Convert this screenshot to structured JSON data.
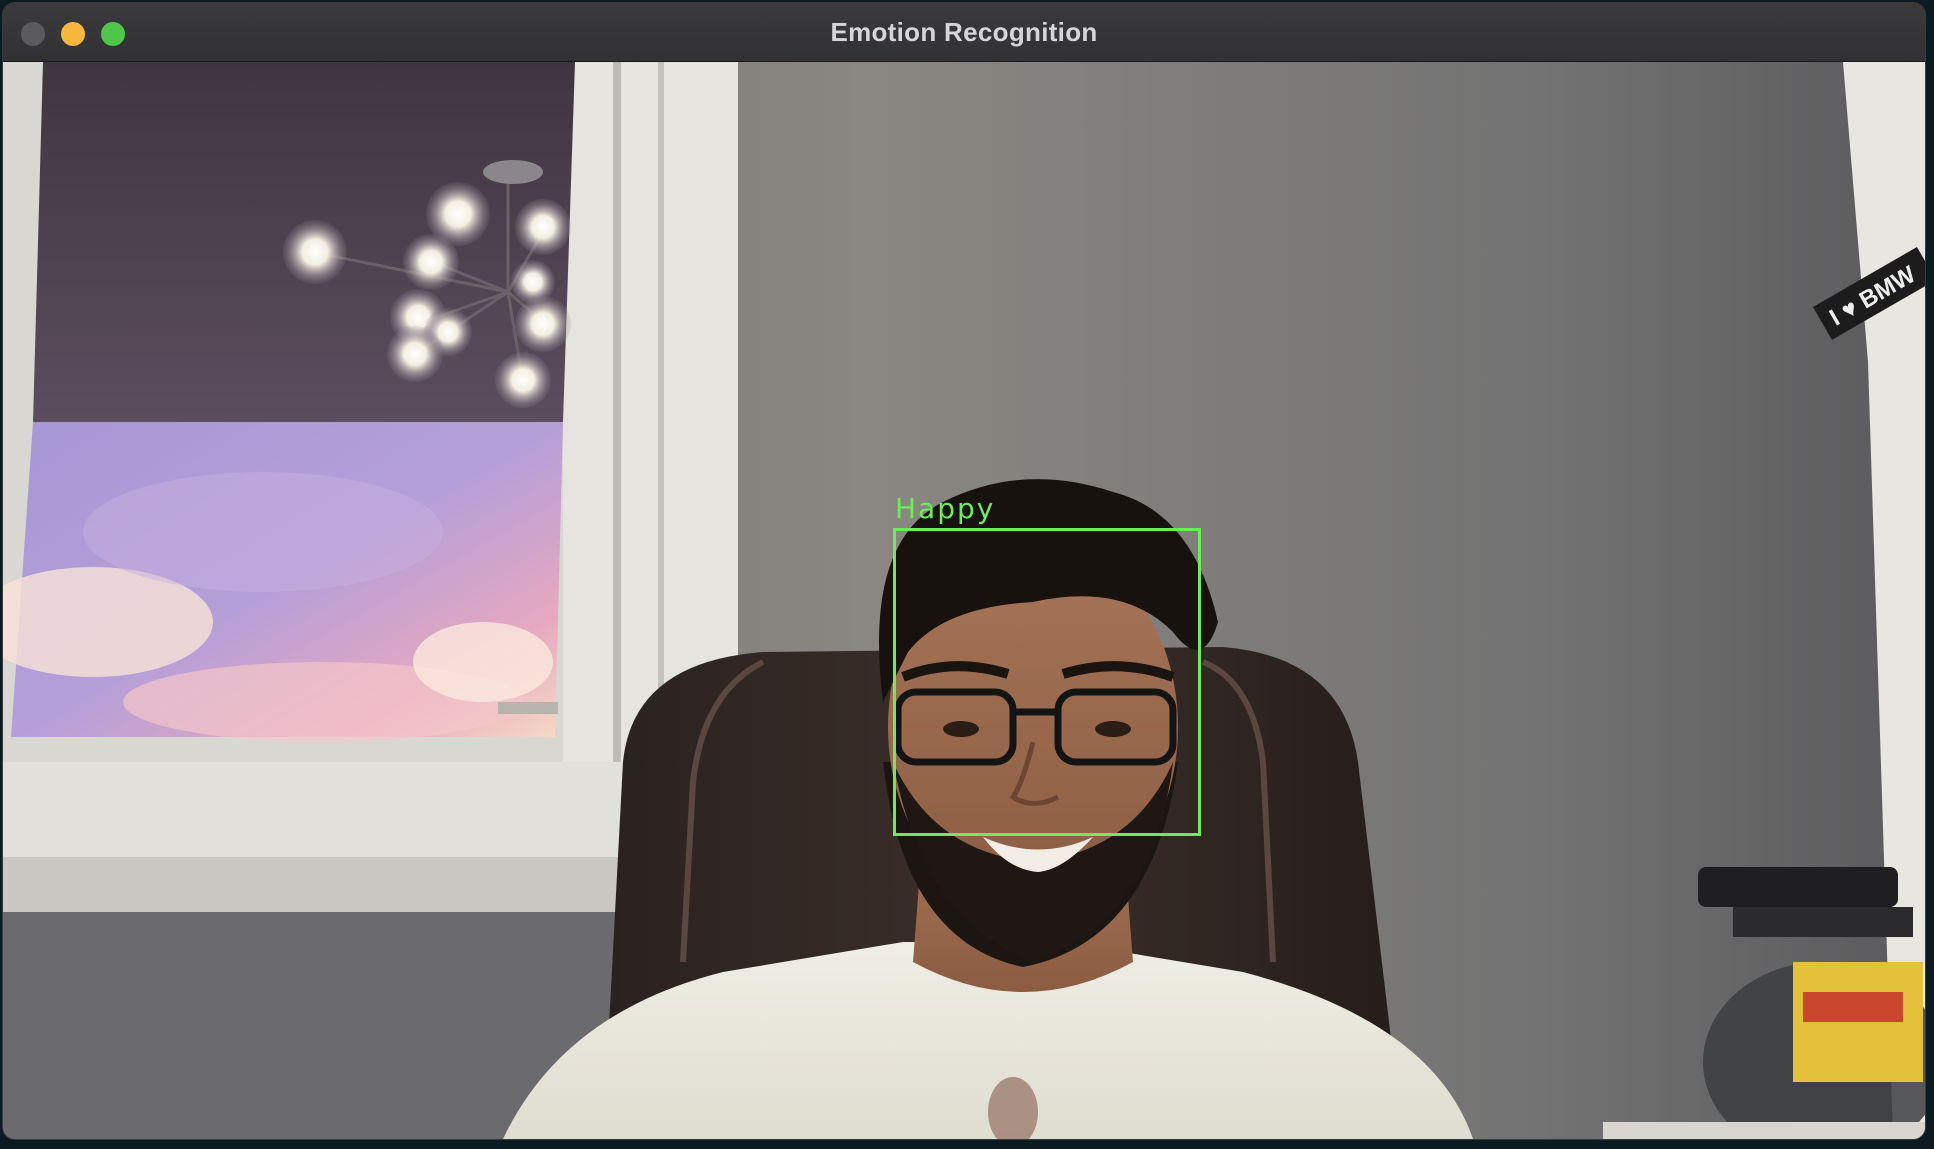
{
  "window": {
    "title": "Emotion Recognition"
  },
  "detection": {
    "label": "Happy",
    "box_color": "#6dec5a"
  },
  "scene": {
    "sticker_text": "I ♥ BMW"
  }
}
